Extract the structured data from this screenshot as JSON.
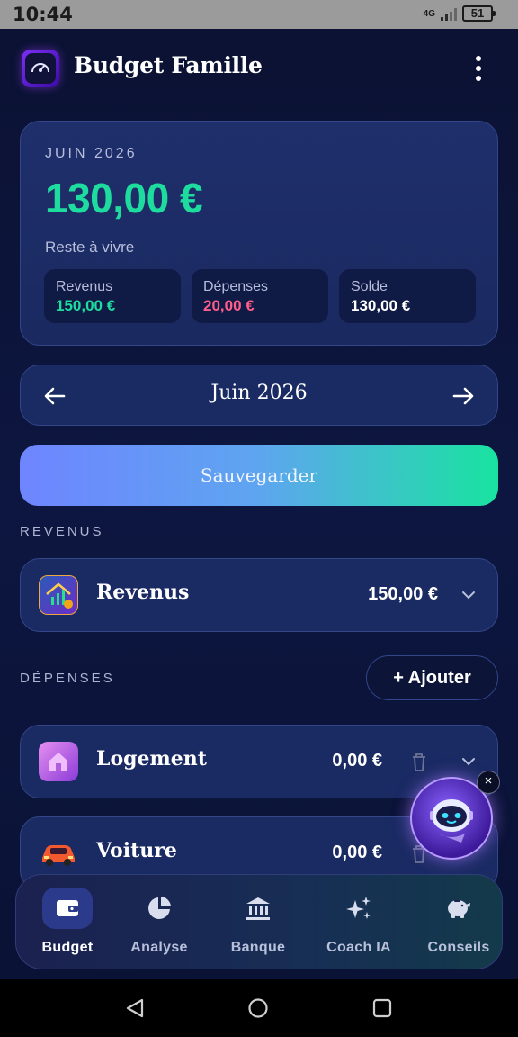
{
  "status_bar": {
    "time": "10:44",
    "network": "4G",
    "battery": "51"
  },
  "header": {
    "title": "Budget Famille",
    "menu_icon": "more-vert-icon"
  },
  "summary": {
    "month": "JUIN 2026",
    "amount": "130,00 €",
    "label": "Reste à vivre",
    "stats": [
      {
        "label": "Revenus",
        "value": "150,00 €",
        "color": "#1ddc9e"
      },
      {
        "label": "Dépenses",
        "value": "20,00 €",
        "color": "#ff5d8a"
      },
      {
        "label": "Solde",
        "value": "130,00 €",
        "color": "#ffffff"
      }
    ]
  },
  "month_nav": {
    "label": "Juin 2026",
    "prev_icon": "arrow-left-icon",
    "next_icon": "arrow-right-icon"
  },
  "save_button": {
    "label": "Sauvegarder"
  },
  "revenus_section": {
    "title": "REVENUS",
    "items": [
      {
        "name": "Revenus",
        "amount": "150,00 €",
        "icon": "income-chart-icon"
      }
    ]
  },
  "depenses_section": {
    "title": "DÉPENSES",
    "add_label": "+ Ajouter",
    "items": [
      {
        "name": "Logement",
        "amount": "0,00 €",
        "icon": "house-icon"
      },
      {
        "name": "Voiture",
        "amount": "0,00 €",
        "icon": "car-icon"
      }
    ]
  },
  "assistant": {
    "icon": "robot-assistant-icon",
    "close": "×"
  },
  "bottom_nav": {
    "items": [
      {
        "label": "Budget",
        "icon": "wallet-icon",
        "active": true
      },
      {
        "label": "Analyse",
        "icon": "pie-chart-icon",
        "active": false
      },
      {
        "label": "Banque",
        "icon": "bank-icon",
        "active": false
      },
      {
        "label": "Coach IA",
        "icon": "sparkles-icon",
        "active": false
      },
      {
        "label": "Conseils",
        "icon": "piggy-bank-icon",
        "active": false
      }
    ]
  },
  "colors": {
    "accent_green": "#1ddc9e",
    "accent_pink": "#ff5d8a",
    "background": "#0b1233",
    "card": "#1a2a63"
  }
}
